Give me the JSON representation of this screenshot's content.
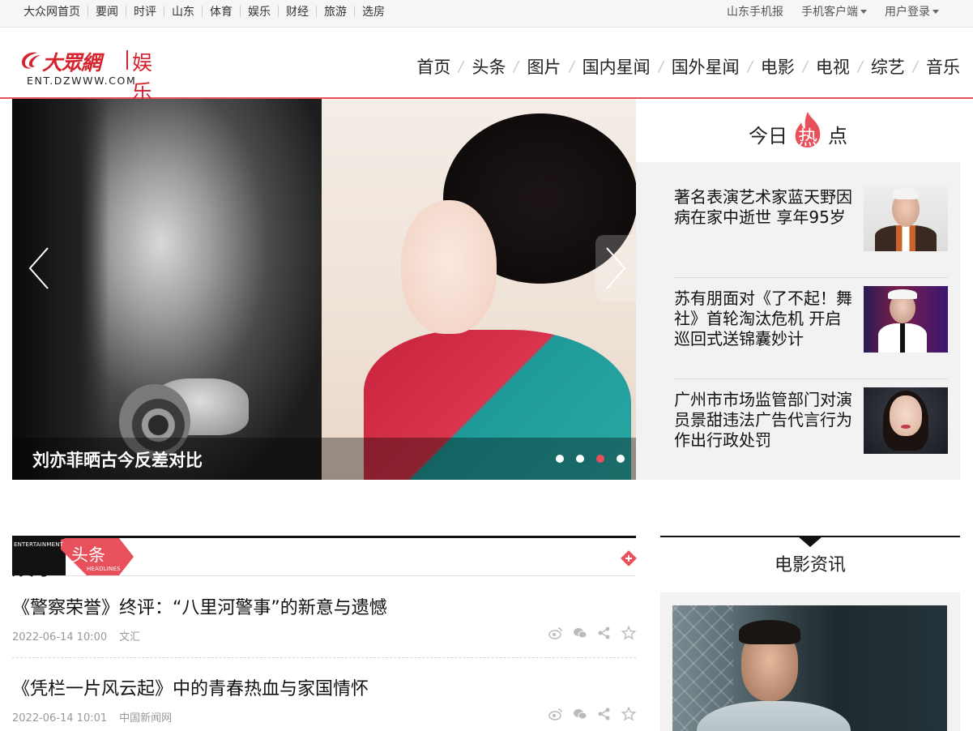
{
  "topbar": {
    "links": [
      "大众网首页",
      "要闻",
      "时评",
      "山东",
      "体育",
      "娱乐",
      "财经",
      "旅游",
      "选房"
    ],
    "right": {
      "mobile_news": "山东手机报",
      "client": "手机客户端",
      "login": "用户登录"
    }
  },
  "header": {
    "logo": {
      "brand": "大眾網",
      "channel": "娱乐",
      "url": "ENT.DZWWW.COM"
    },
    "nav": [
      "首页",
      "头条",
      "图片",
      "国内星闻",
      "国外星闻",
      "电影",
      "电视",
      "综艺",
      "音乐"
    ]
  },
  "slider": {
    "caption": "刘亦菲晒古今反差对比",
    "dots": 4,
    "active_dot": 3
  },
  "hot": {
    "title_left": "今日",
    "title_mid": "热",
    "title_right": "点",
    "items": [
      {
        "title": "著名表演艺术家蓝天野因病在家中逝世 享年95岁"
      },
      {
        "title": "苏有朋面对《了不起！舞社》首轮淘汰危机 开启巡回式送锦囊妙计"
      },
      {
        "title": "广州市市场监管部门对演员景甜违法广告代言行为作出行政处罚"
      }
    ]
  },
  "headlines": {
    "section": {
      "en_top": "ENTERTAINMENT",
      "cn_main": "娱乐",
      "cn_tag": "头条",
      "en_bottom": "HEADLINES"
    },
    "articles": [
      {
        "title": "《警察荣誉》终评：“八里河警事”的新意与遗憾",
        "time": "2022-06-14 10:00",
        "source": "文汇"
      },
      {
        "title": "《凭栏一片风云起》中的青春热血与家国情怀",
        "time": "2022-06-14 10:01",
        "source": "中国新闻网"
      }
    ]
  },
  "movie": {
    "title": "电影资讯"
  },
  "colors": {
    "accent": "#e8505b",
    "brand_red": "#d5232d"
  }
}
